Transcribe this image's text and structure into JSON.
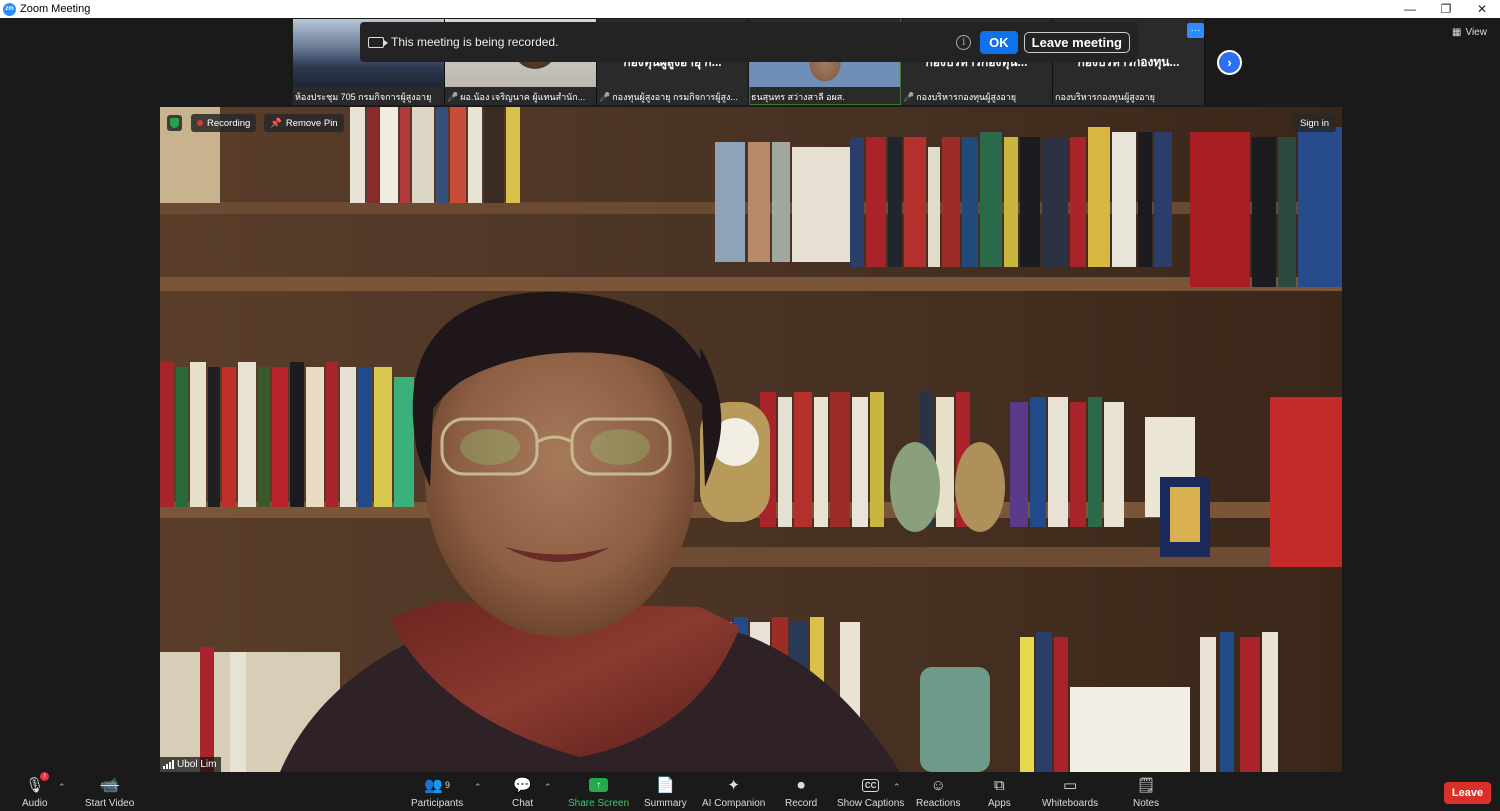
{
  "window": {
    "logo": "zm",
    "title": "Zoom Meeting",
    "controls": [
      "—",
      "❐",
      "✕"
    ]
  },
  "thumbnails": [
    {
      "name": "ห้องประชุม 705 กรมกิจการผู้สูงอายุ",
      "muted": false,
      "header": ""
    },
    {
      "name": "ผอ.น้อง  เจริญนาค ผู้แทนสำนัก...",
      "muted": true,
      "header": ""
    },
    {
      "name": "กองทุนผู้สูงอายุ กรมกิจการผู้สูง...",
      "muted": true,
      "header": "กองทุนผู้สูงอายุ ก..."
    },
    {
      "name": "ธนสุนทร สว่างสาลี อผส.",
      "muted": false,
      "header": ""
    },
    {
      "name": "กองบริหารกองทุนผู้สูงอายุ",
      "muted": true,
      "header": "กองบริหารกองทุน..."
    },
    {
      "name": "กองบริหารกองทุนผู้สูงอายุ",
      "muted": false,
      "header": "กองบริหารกองทุน..."
    }
  ],
  "strip": {
    "more": "···",
    "next": "›",
    "view_label": "View"
  },
  "banner": {
    "message": "This meeting is being recorded.",
    "info": "i",
    "ok_label": "OK",
    "leave_label": "Leave meeting"
  },
  "main": {
    "recording_label": "Recording",
    "remove_pin_label": "Remove Pin",
    "sign_in_label": "Sign in",
    "participant_name": "Ubol Lim"
  },
  "toolbar": {
    "audio": "Audio",
    "start_video": "Start Video",
    "participants": "Participants",
    "participant_count": "9",
    "chat": "Chat",
    "share_screen": "Share Screen",
    "summary": "Summary",
    "ai_companion": "AI Companion",
    "record": "Record",
    "show_captions": "Show Captions",
    "cc": "CC",
    "reactions": "Reactions",
    "apps": "Apps",
    "whiteboards": "Whiteboards",
    "notes": "Notes",
    "leave": "Leave",
    "audio_badge": "!"
  },
  "colors": {
    "accent_blue": "#0e72ed",
    "share_green": "#23a94e",
    "leave_red": "#d9312a",
    "recording_red": "#e8323a"
  }
}
